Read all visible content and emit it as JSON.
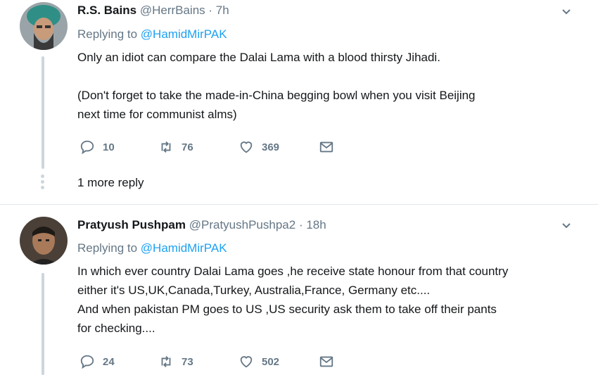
{
  "tweets": [
    {
      "name": "R.S. Bains",
      "handle": "@HerrBains",
      "time": "· 7h",
      "replying_label": "Replying to",
      "replying_to": "@HamidMirPAK",
      "lines": [
        "Only an idiot can compare the Dalai Lama with a blood thirsty Jihadi.",
        "",
        "(Don't forget to take the made-in-China begging bowl when you visit Beijing",
        "next time for communist alms)"
      ],
      "replies": "10",
      "retweets": "76",
      "likes": "369",
      "more_replies": "1 more reply"
    },
    {
      "name": "Pratyush Pushpam",
      "handle": "@PratyushPushpa2",
      "time": "· 18h",
      "replying_label": "Replying to",
      "replying_to": "@HamidMirPAK",
      "lines": [
        "In which ever country Dalai Lama goes ,he receive state honour from that country",
        "either it's US,UK,Canada,Turkey, Australia,France, Germany etc....",
        "And when pakistan PM goes to US ,US security ask them to take off their pants",
        "for checking...."
      ],
      "replies": "24",
      "retweets": "73",
      "likes": "502"
    }
  ],
  "colors": {
    "text": "#14171a",
    "secondary": "#657786",
    "link": "#1da1f2",
    "thread_line": "#ccd6dd",
    "divider": "#e1e8ed"
  },
  "icons": [
    "reply-icon",
    "retweet-icon",
    "like-icon",
    "direct-message-icon",
    "chevron-down-icon"
  ]
}
